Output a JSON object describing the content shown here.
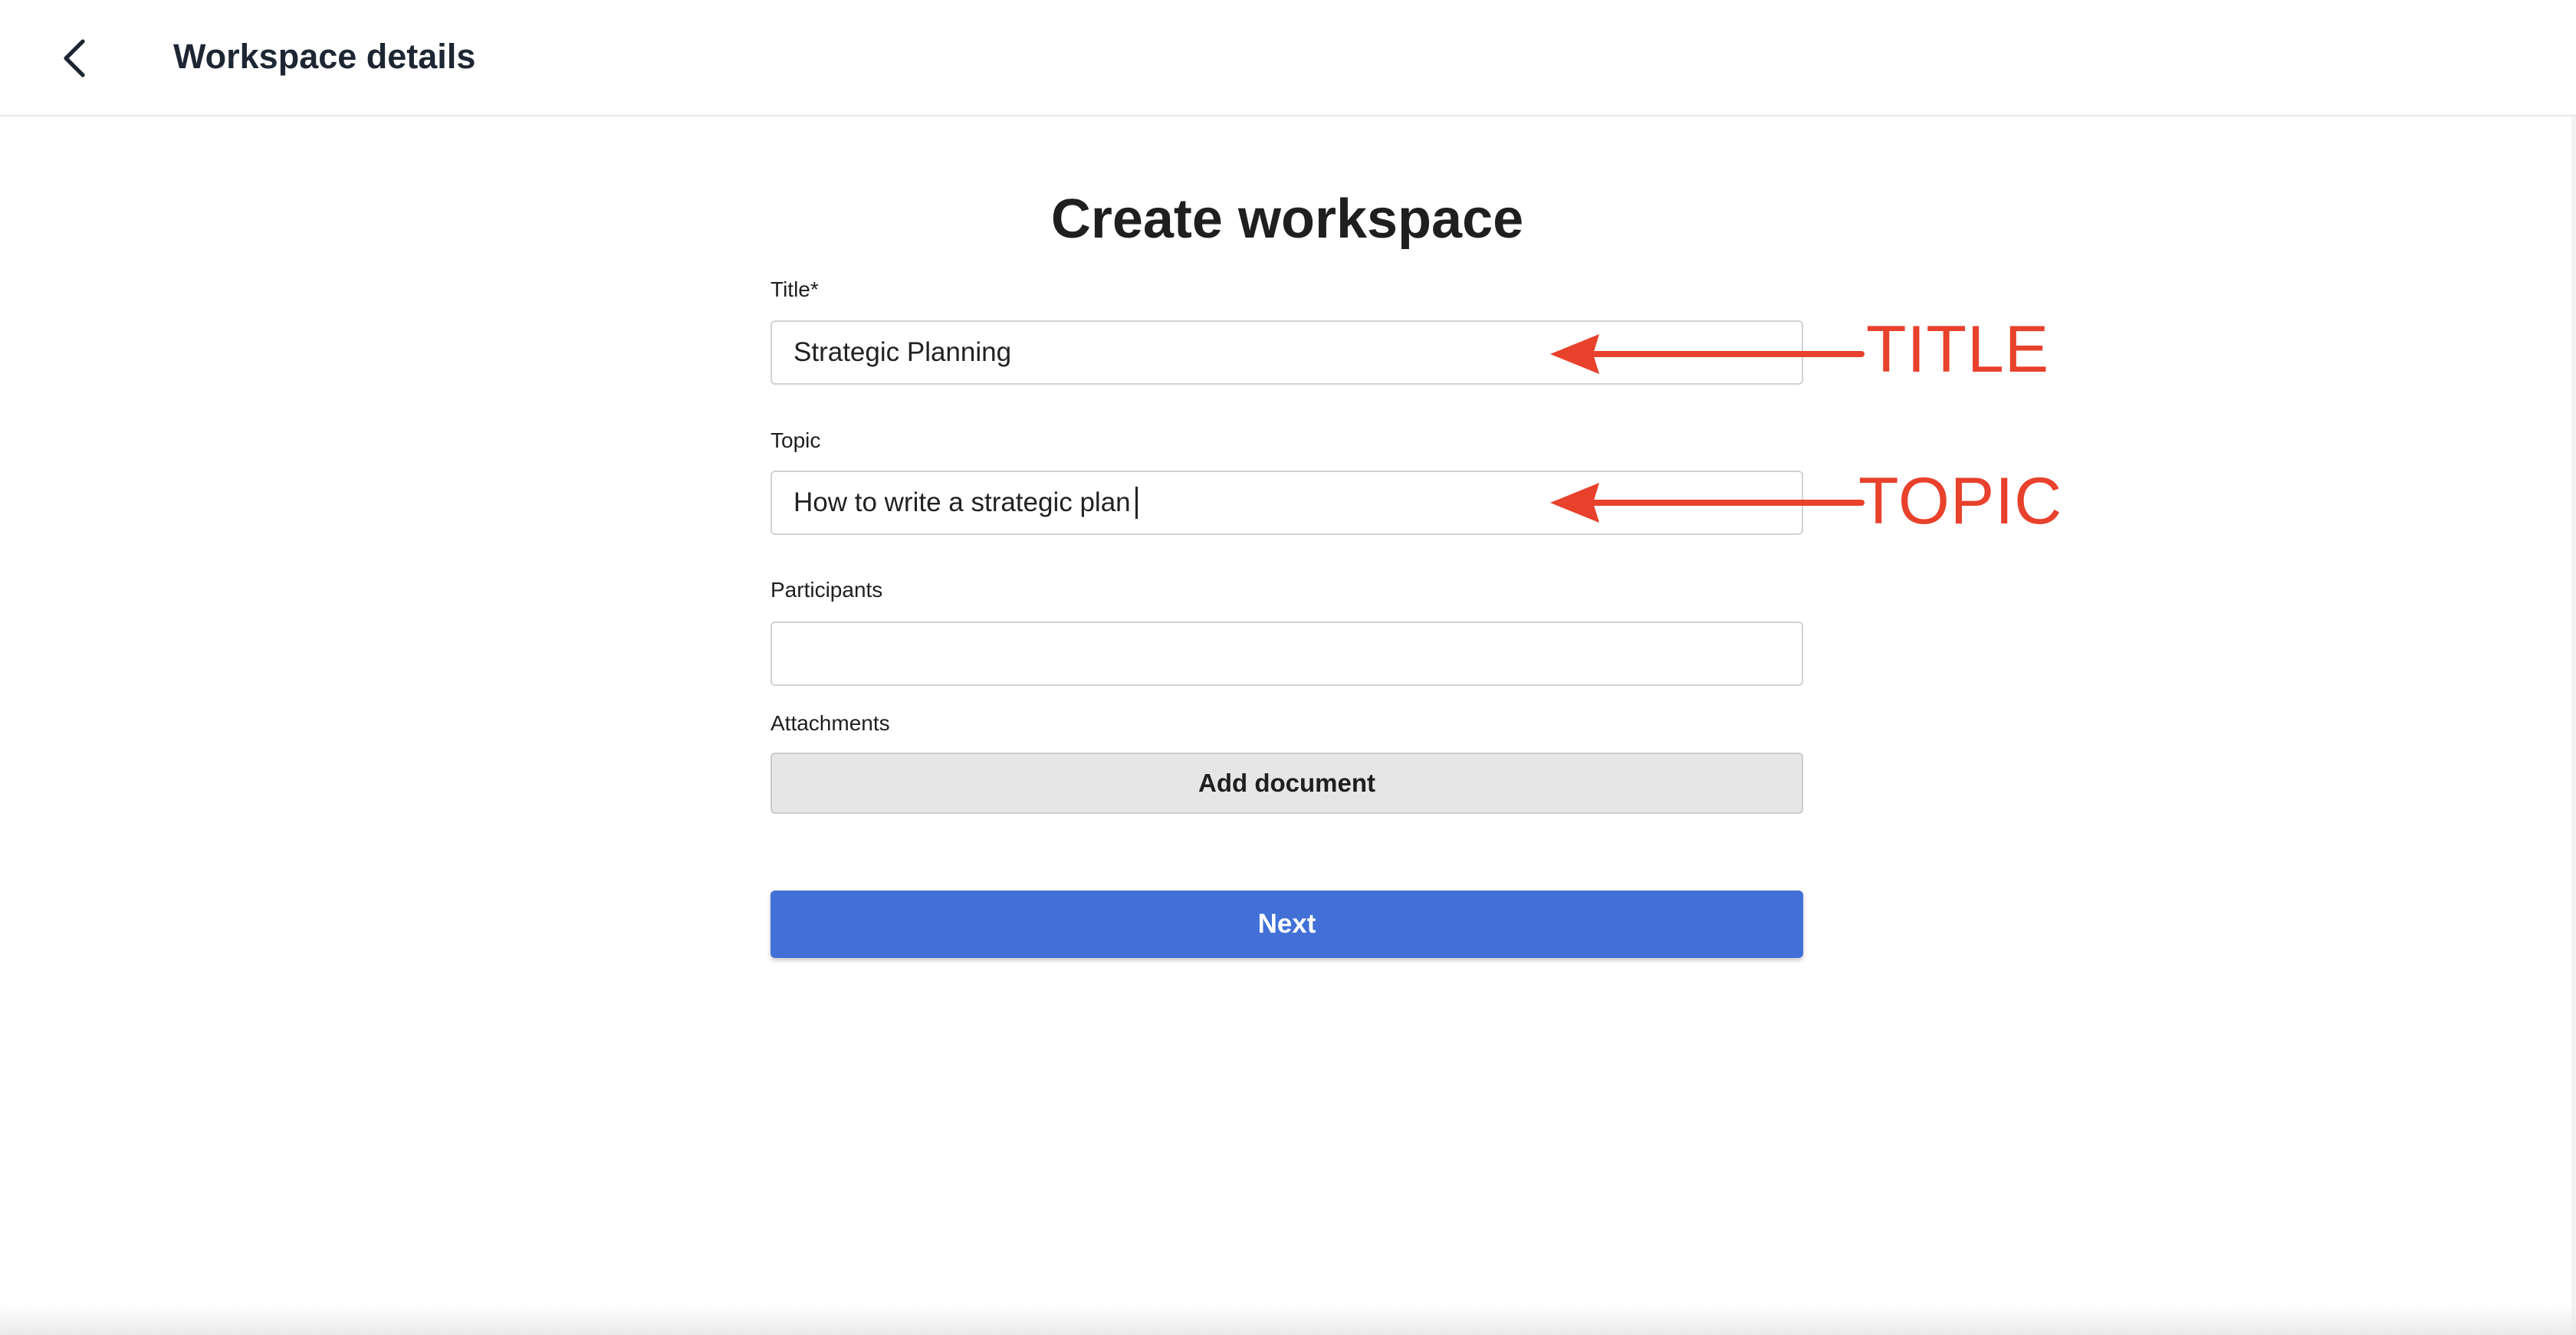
{
  "header": {
    "title": "Workspace details",
    "back_icon": "chevron-left-icon"
  },
  "form": {
    "heading": "Create workspace",
    "title_field": {
      "label": "Title*",
      "value": "Strategic Planning",
      "placeholder": ""
    },
    "topic_field": {
      "label": "Topic",
      "value": "How to write a strategic plan",
      "placeholder": ""
    },
    "participants_field": {
      "label": "Participants",
      "value": "",
      "placeholder": ""
    },
    "attachments": {
      "label": "Attachments",
      "add_button": "Add document"
    },
    "next_button": "Next"
  },
  "annotations": {
    "title_label": "TITLE",
    "topic_label": "TOPIC",
    "color": "#e8412c"
  },
  "colors": {
    "primary": "#4270d6",
    "secondary_button": "#e6e6e6",
    "border": "#cfd3d8"
  }
}
